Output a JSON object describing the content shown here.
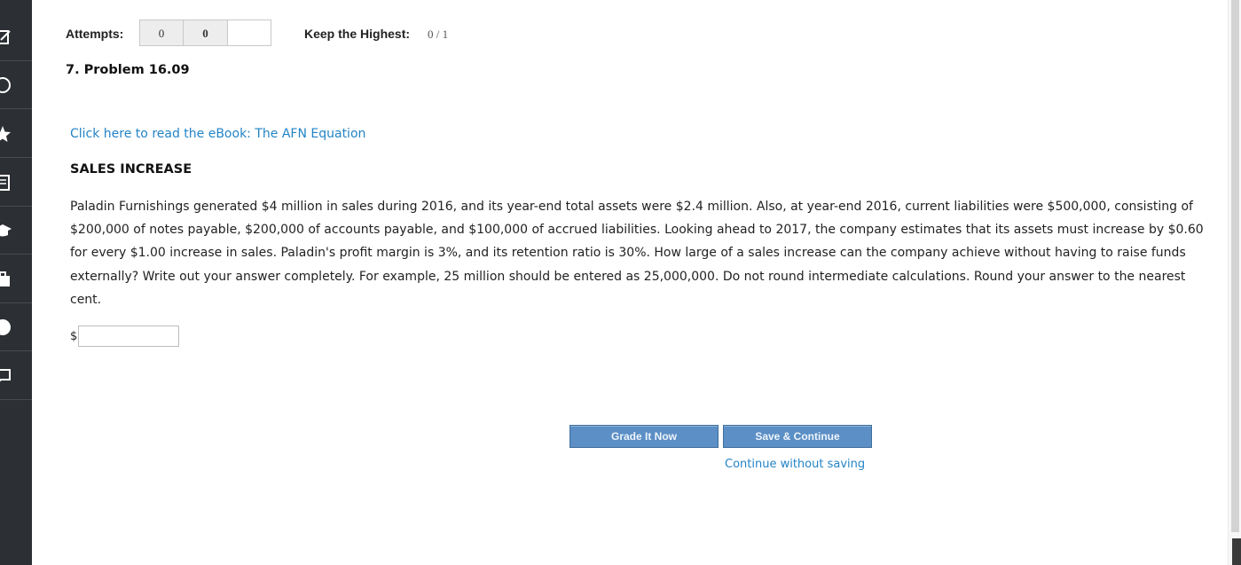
{
  "attempts": {
    "label": "Attempts:",
    "box1": "0",
    "box2": "0",
    "box3": "",
    "keep_label": "Keep the Highest:",
    "keep_value": "0 / 1"
  },
  "problem": {
    "title": "7.  Problem 16.09",
    "ebook_link": "Click here to read the eBook: The AFN Equation",
    "section_heading": "SALES INCREASE",
    "text": "Paladin Furnishings generated $4 million in sales during 2016, and its year-end total assets were $2.4 million. Also, at year-end 2016, current liabilities were $500,000, consisting of $200,000 of notes payable, $200,000 of accounts payable, and $100,000 of accrued liabilities. Looking ahead to 2017, the company estimates that its assets must increase by $0.60 for every $1.00 increase in sales. Paladin's profit margin is 3%, and its retention ratio is 30%. How large of a sales increase can the company achieve without having to raise funds externally? Write out your answer completely. For example, 25 million should be entered as 25,000,000. Do not round intermediate calculations. Round your answer to the nearest cent."
  },
  "answer": {
    "currency_symbol": "$",
    "value": ""
  },
  "actions": {
    "grade_label": "Grade It Now",
    "save_label": "Save & Continue",
    "continue_label": "Continue without saving"
  },
  "sidebar": {
    "icons": [
      "edit-icon",
      "clock-icon",
      "star-icon",
      "book-icon",
      "graduation-cap-icon",
      "briefcase-icon",
      "help-icon",
      "chat-icon"
    ]
  },
  "colors": {
    "sidebar_bg": "#2c2f33",
    "link": "#2384c6",
    "button_bg": "#5b8fc5"
  }
}
